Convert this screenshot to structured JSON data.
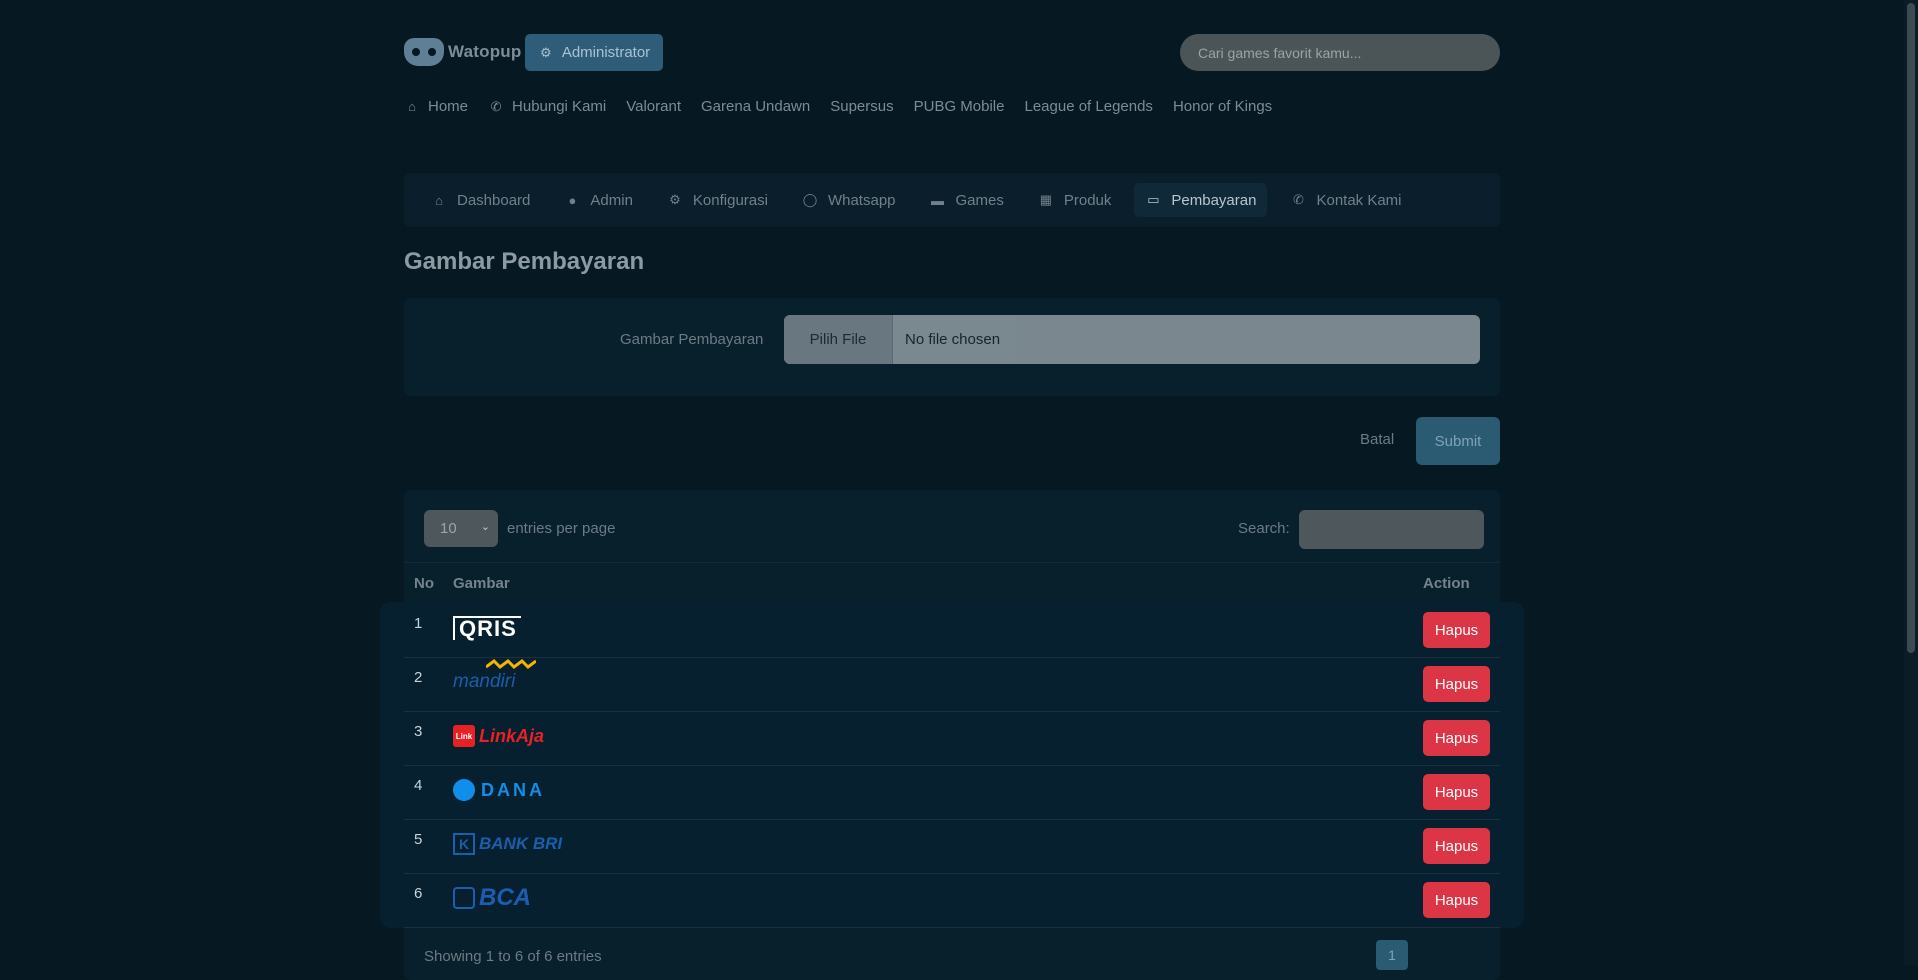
{
  "brand": {
    "name": "Watopup"
  },
  "header": {
    "admin_label": "Administrator",
    "search_placeholder": "Cari games favorit kamu..."
  },
  "topnav": {
    "items": [
      "Home",
      "Hubungi Kami",
      "Valorant",
      "Garena Undawn",
      "Supersus",
      "PUBG Mobile",
      "League of Legends",
      "Honor of Kings"
    ]
  },
  "tabs": {
    "items": [
      "Dashboard",
      "Admin",
      "Konfigurasi",
      "Whatsapp",
      "Games",
      "Produk",
      "Pembayaran",
      "Kontak Kami"
    ],
    "active": "Pembayaran"
  },
  "page": {
    "title": "Gambar Pembayaran"
  },
  "form": {
    "label": "Gambar Pembayaran",
    "file_button": "Pilih File",
    "file_status": "No file chosen",
    "cancel_label": "Batal",
    "submit_label": "Submit"
  },
  "table": {
    "page_length": "10",
    "length_suffix": "entries per page",
    "search_label": "Search:",
    "columns": {
      "no": "No",
      "image": "Gambar",
      "action": "Action"
    },
    "rows": [
      {
        "no": "1",
        "logo": "QRIS",
        "action": "Hapus"
      },
      {
        "no": "2",
        "logo": "mandiri",
        "action": "Hapus"
      },
      {
        "no": "3",
        "logo": "LinkAja",
        "action": "Hapus"
      },
      {
        "no": "4",
        "logo": "DANA",
        "action": "Hapus"
      },
      {
        "no": "5",
        "logo": "BANK BRI",
        "action": "Hapus"
      },
      {
        "no": "6",
        "logo": "BCA",
        "action": "Hapus"
      }
    ],
    "info": "Showing 1 to 6 of 6 entries",
    "page": "1"
  },
  "colors": {
    "delete": "#dc3545",
    "accent": "#2f5c78",
    "background": "#061822"
  }
}
